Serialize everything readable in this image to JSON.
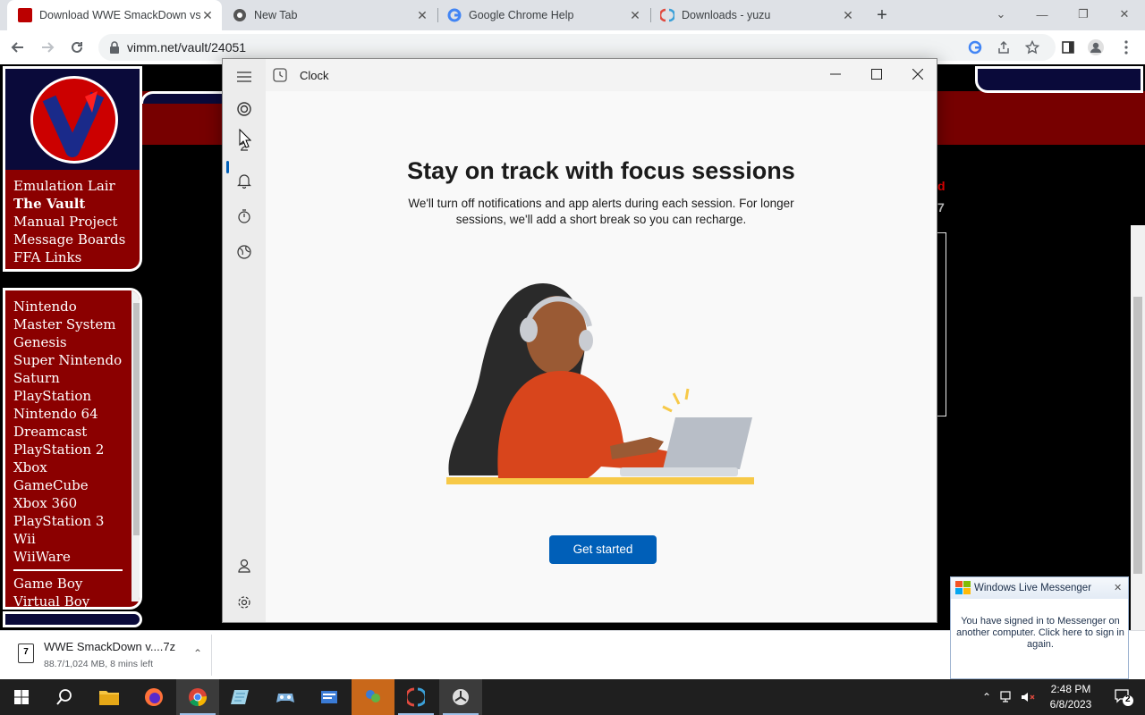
{
  "browser": {
    "tabs": [
      {
        "title": "Download WWE SmackDown vs.",
        "active": true
      },
      {
        "title": "New Tab",
        "active": false
      },
      {
        "title": "Google Chrome Help",
        "active": false
      },
      {
        "title": "Downloads - yuzu",
        "active": false
      }
    ],
    "url": "vimm.net/vault/24051"
  },
  "site": {
    "nav_links": [
      "Emulation Lair",
      "The Vault",
      "Manual Project",
      "Message Boards",
      "FFA Links"
    ],
    "systems_a": [
      "Nintendo",
      "Master System",
      "Genesis",
      "Super Nintendo",
      "Saturn",
      "PlayStation",
      "Nintendo 64",
      "Dreamcast",
      "PlayStation 2",
      "Xbox",
      "GameCube",
      "Xbox 360",
      "PlayStation 3",
      "Wii",
      "WiiWare"
    ],
    "systems_b": [
      "Game Boy",
      "Virtual Boy"
    ],
    "right_fragment": "d",
    "right_fragment2": "7"
  },
  "clock_app": {
    "title": "Clock",
    "headline": "Stay on track with focus sessions",
    "subtext": "We'll turn off notifications and app alerts during each session. For longer sessions, we'll add a short break so you can recharge.",
    "cta": "Get started",
    "accent": "#005fb8"
  },
  "download": {
    "name": "WWE SmackDown v....7z",
    "status": "88.7/1,024 MB, 8 mins left",
    "icon_label": "7"
  },
  "messenger": {
    "title": "Windows Live Messenger",
    "body": "You have signed in to Messenger on another computer. Click here to sign in again."
  },
  "taskbar": {
    "time": "2:48 PM",
    "date": "6/8/2023",
    "notification_count": "2"
  }
}
